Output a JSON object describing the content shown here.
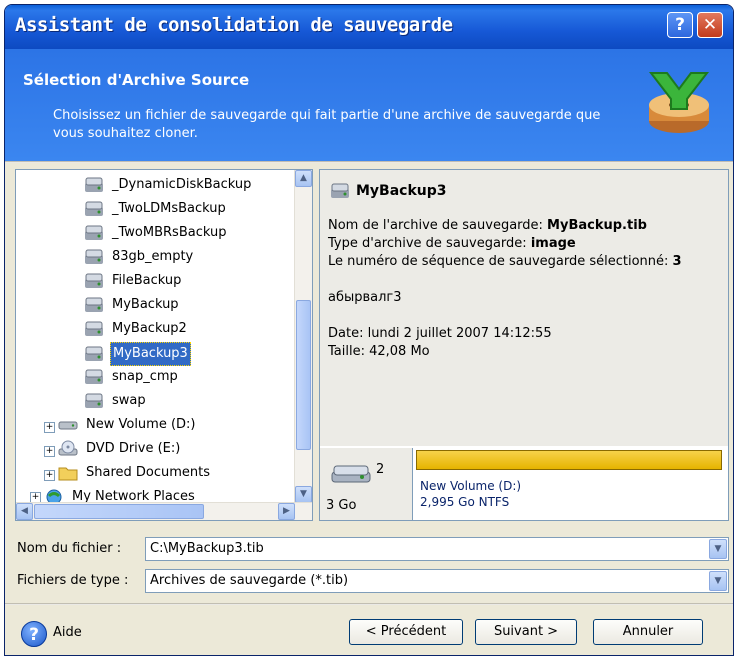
{
  "window": {
    "title": "Assistant de consolidation de sauvegarde",
    "help_button": "?",
    "close_button": "✕"
  },
  "header": {
    "title": "Sélection d'Archive Source",
    "description": "Choisissez un fichier de sauvegarde qui fait partie d'une archive de sauvegarde que vous souhaitez cloner.",
    "icon": "consolidate-archive-icon"
  },
  "tree": {
    "items": [
      {
        "label": "_DynamicDiskBackup",
        "icon": "archive-icon"
      },
      {
        "label": "_TwoLDMsBackup",
        "icon": "archive-icon"
      },
      {
        "label": "_TwoMBRsBackup",
        "icon": "archive-icon"
      },
      {
        "label": "83gb_empty",
        "icon": "archive-icon"
      },
      {
        "label": "FileBackup",
        "icon": "archive-icon"
      },
      {
        "label": "MyBackup",
        "icon": "archive-icon"
      },
      {
        "label": "MyBackup2",
        "icon": "archive-icon"
      },
      {
        "label": "MyBackup3",
        "icon": "archive-icon",
        "selected": true
      },
      {
        "label": "snap_cmp",
        "icon": "archive-icon"
      },
      {
        "label": "swap",
        "icon": "archive-icon"
      },
      {
        "label": "New Volume (D:)",
        "icon": "drive-icon",
        "expander": "+"
      },
      {
        "label": "DVD Drive (E:)",
        "icon": "dvd-drive-icon",
        "expander": "+"
      },
      {
        "label": "Shared Documents",
        "icon": "folder-icon",
        "expander": "+"
      },
      {
        "label": "My Network Places",
        "icon": "network-places-icon",
        "expander": "+"
      }
    ]
  },
  "details": {
    "name": "MyBackup3",
    "archive_name_label": "Nom de l'archive de sauvegarde:",
    "archive_name_value": "MyBackup.tib",
    "archive_type_label": "Type d'archive de sauvegarde:",
    "archive_type_value": "image",
    "sequence_label": "Le numéro de séquence de sauvegarde sélectionné:",
    "sequence_value": "3",
    "comment": "абырвалг3",
    "date": "Date: lundi 2 juillet 2007 14:12:55",
    "size": "Taille: 42,08 Mo",
    "disk": {
      "number": "2",
      "capacity": "3 Go",
      "volume_name": "New Volume (D:)",
      "volume_info": "2,995 Go  NTFS",
      "bar_color": "#e6b400"
    }
  },
  "fields": {
    "filename_label": "Nom du fichier :",
    "filename_value": "C:\\MyBackup3.tib",
    "filetype_label": "Fichiers de type :",
    "filetype_value": "Archives de sauvegarde (*.tib)"
  },
  "footer": {
    "help_label": "Aide",
    "prev_label": "< Précédent",
    "next_label": "Suivant >",
    "cancel_label": "Annuler"
  }
}
